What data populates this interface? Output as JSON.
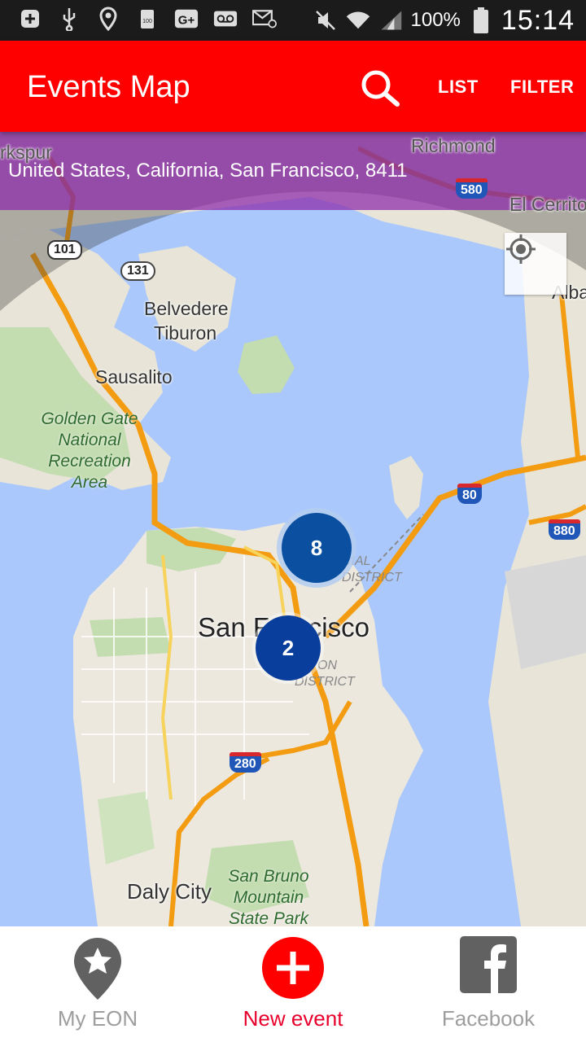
{
  "status_bar": {
    "battery_text": "100%",
    "time": "15:14",
    "icons": [
      "plus-box-icon",
      "usb-icon",
      "location-pin-icon",
      "battery-100-icon",
      "google-plus-icon",
      "voicemail-icon",
      "email-icon",
      "mute-icon",
      "wifi-icon",
      "signal-icon",
      "battery-icon"
    ]
  },
  "app_bar": {
    "title": "Events Map",
    "list_label": "LIST",
    "filter_label": "FILTER",
    "background": "#ff0000"
  },
  "map": {
    "address": "United States, California, San Francisco, 8411",
    "labels": {
      "richmond": "Richmond",
      "el_cerrito": "El Cerrito",
      "larkspur": "rkspur",
      "albany": "Alba",
      "belvedere": "Belvedere",
      "tiburon": "Tiburon",
      "sausalito": "Sausalito",
      "san_francisco": "San Francisco",
      "daly_city": "Daly City"
    },
    "parks": {
      "golden_gate": [
        "Golden Gate",
        "National",
        "Recreation",
        "Area"
      ],
      "san_bruno": [
        "San Bruno",
        "Mountain",
        "State Park"
      ]
    },
    "districts": {
      "financial": [
        "CIAL",
        "DISTRICT"
      ],
      "mission": [
        "ON",
        "DISTRICT"
      ]
    },
    "shields": {
      "us101": "101",
      "ca131": "131",
      "i580": "580",
      "i80": "80",
      "i880": "880",
      "i280": "280"
    },
    "clusters": [
      {
        "count": "8"
      },
      {
        "count": "2"
      }
    ]
  },
  "bottom_nav": {
    "items": [
      {
        "label": "My EON",
        "icon": "star-pin-icon"
      },
      {
        "label": "New event",
        "icon": "plus-circle-icon",
        "color": "#e8002c"
      },
      {
        "label": "Facebook",
        "icon": "facebook-icon"
      }
    ]
  }
}
